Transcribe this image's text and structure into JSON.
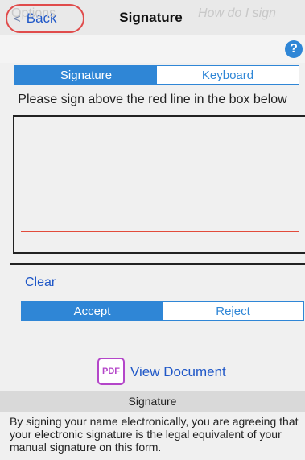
{
  "header": {
    "back_label": "Back",
    "title": "Signature"
  },
  "options": {
    "label": "Options",
    "help_text": "How do I sign",
    "help_icon": "?"
  },
  "mode_tabs": [
    {
      "label": "Signature",
      "active": true
    },
    {
      "label": "Keyboard",
      "active": false
    }
  ],
  "instruction": "Please sign above the red line in the box below",
  "signature_pad": {
    "line_color": "#e24b3b"
  },
  "clear_label": "Clear",
  "decision": [
    {
      "label": "Accept",
      "active": true
    },
    {
      "label": "Reject",
      "active": false
    }
  ],
  "document": {
    "icon_label": "PDF",
    "link_label": "View Document"
  },
  "footer": {
    "title": "Signature",
    "disclaimer": "By signing your name electronically, you are agreeing that your electronic signature is the legal equivalent of your manual signature on this form."
  },
  "colors": {
    "accent": "#2f86d6",
    "link": "#1f57c7",
    "highlight_ring": "#e04b4b",
    "pdf": "#b446c9"
  }
}
